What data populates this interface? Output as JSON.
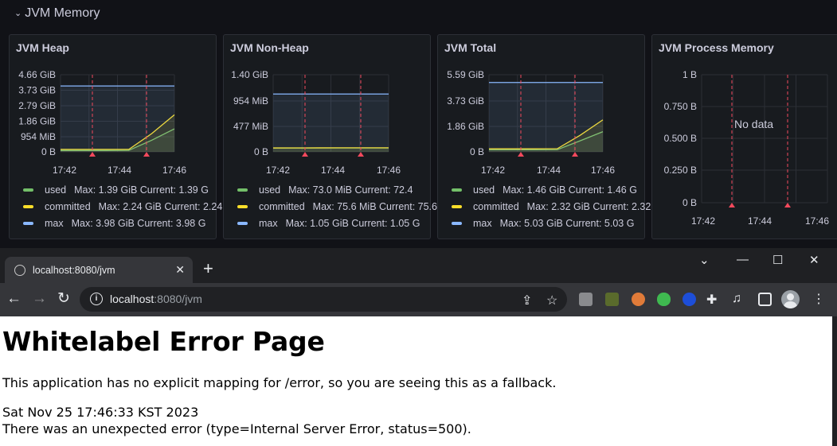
{
  "row": {
    "title": "JVM Memory"
  },
  "colors": {
    "used": "#73bf69",
    "committed": "#fade2a",
    "max": "#8ab8ff",
    "annotation": "#f2495c"
  },
  "panels": [
    {
      "title": "JVM Heap",
      "yticks": [
        "4.66 GiB",
        "3.73 GiB",
        "2.79 GiB",
        "1.86 GiB",
        "954 MiB",
        "0 B"
      ],
      "xticks": [
        "17:42",
        "17:44",
        "17:46"
      ],
      "legend": [
        {
          "name": "used",
          "stats": "Max: 1.39 GiB  Current: 1.39 G"
        },
        {
          "name": "committed",
          "stats": "Max: 2.24 GiB  Current: 2.24"
        },
        {
          "name": "max",
          "stats": "Max: 3.98 GiB  Current: 3.98 G"
        }
      ]
    },
    {
      "title": "JVM Non-Heap",
      "yticks": [
        "1.40 GiB",
        "954 MiB",
        "477 MiB",
        "0 B"
      ],
      "xticks": [
        "17:42",
        "17:44",
        "17:46"
      ],
      "legend": [
        {
          "name": "used",
          "stats": "Max: 73.0 MiB  Current: 72.4"
        },
        {
          "name": "committed",
          "stats": "Max: 75.6 MiB  Current: 75.6"
        },
        {
          "name": "max",
          "stats": "Max: 1.05 GiB  Current: 1.05 G"
        }
      ]
    },
    {
      "title": "JVM Total",
      "yticks": [
        "5.59 GiB",
        "3.73 GiB",
        "1.86 GiB",
        "0 B"
      ],
      "xticks": [
        "17:42",
        "17:44",
        "17:46"
      ],
      "legend": [
        {
          "name": "used",
          "stats": "Max: 1.46 GiB  Current: 1.46 G"
        },
        {
          "name": "committed",
          "stats": "Max: 2.32 GiB  Current: 2.32"
        },
        {
          "name": "max",
          "stats": "Max: 5.03 GiB  Current: 5.03 G"
        }
      ]
    },
    {
      "title": "JVM Process Memory",
      "yticks": [
        "1 B",
        "0.750 B",
        "0.500 B",
        "0.250 B",
        "0 B"
      ],
      "xticks": [
        "17:42",
        "17:44",
        "17:46"
      ],
      "nodata": "No data"
    }
  ],
  "chart_data": [
    {
      "type": "area",
      "title": "JVM Heap",
      "x": [
        "17:41",
        "17:42",
        "17:43",
        "17:44",
        "17:45",
        "17:46"
      ],
      "series": [
        {
          "name": "used",
          "values": [
            0.08,
            0.08,
            0.08,
            0.09,
            0.7,
            1.39
          ]
        },
        {
          "name": "committed",
          "values": [
            0.15,
            0.15,
            0.15,
            0.15,
            1.1,
            2.24
          ]
        },
        {
          "name": "max",
          "values": [
            3.98,
            3.98,
            3.98,
            3.98,
            3.98,
            3.98
          ]
        }
      ],
      "ylim": [
        0,
        4.66
      ],
      "yunit": "GiB"
    },
    {
      "type": "area",
      "title": "JVM Non-Heap",
      "x": [
        "17:41",
        "17:42",
        "17:43",
        "17:44",
        "17:45",
        "17:46"
      ],
      "series": [
        {
          "name": "used",
          "values": [
            70,
            71,
            72,
            72,
            72.4,
            72.4
          ]
        },
        {
          "name": "committed",
          "values": [
            73,
            74,
            75,
            75.6,
            75.6,
            75.6
          ]
        },
        {
          "name": "max",
          "values": [
            1075,
            1075,
            1075,
            1075,
            1075,
            1075
          ]
        }
      ],
      "ylim": [
        0,
        1434
      ],
      "yunit": "MiB"
    },
    {
      "type": "area",
      "title": "JVM Total",
      "x": [
        "17:41",
        "17:42",
        "17:43",
        "17:44",
        "17:45",
        "17:46"
      ],
      "series": [
        {
          "name": "used",
          "values": [
            0.15,
            0.15,
            0.15,
            0.16,
            0.8,
            1.46
          ]
        },
        {
          "name": "committed",
          "values": [
            0.22,
            0.22,
            0.22,
            0.23,
            1.2,
            2.32
          ]
        },
        {
          "name": "max",
          "values": [
            5.03,
            5.03,
            5.03,
            5.03,
            5.03,
            5.03
          ]
        }
      ],
      "ylim": [
        0,
        5.59
      ],
      "yunit": "GiB"
    },
    {
      "type": "line",
      "title": "JVM Process Memory",
      "x": [
        "17:42",
        "17:44",
        "17:46"
      ],
      "series": [],
      "ylim": [
        0,
        1
      ]
    }
  ],
  "browser": {
    "tab_title": "localhost:8080/jvm",
    "new_tab": "+",
    "url_host": "localhost",
    "url_rest": ":8080/jvm",
    "minimize": "—",
    "restore": "☐",
    "close": "✕",
    "tabsearch": "⌄"
  },
  "page": {
    "heading": "Whitelabel Error Page",
    "line1": "This application has no explicit mapping for /error, so you are seeing this as a fallback.",
    "line2": "Sat Nov 25 17:46:33 KST 2023",
    "line3": "There was an unexpected error (type=Internal Server Error, status=500)."
  }
}
